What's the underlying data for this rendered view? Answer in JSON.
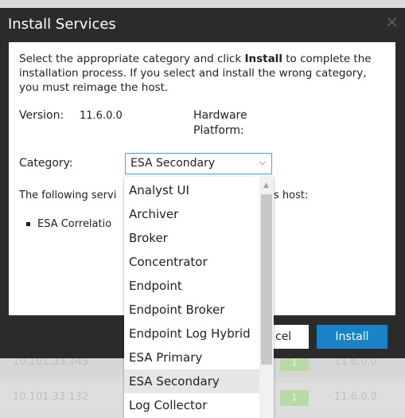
{
  "dialog": {
    "title": "Install Services",
    "close_glyph": "✕",
    "intro_before": "Select the appropriate category and click ",
    "intro_bold": "Install",
    "intro_after": " to complete the installation process. If you select and install the wrong category, you must reimage the host.",
    "version_label": "Version:",
    "version_value": "11.6.0.0",
    "hardware_label_1": "Hardware",
    "hardware_label_2": "Platform:",
    "category_label": "Category:",
    "category_selected": "ESA Secondary",
    "following_text": "The following servi",
    "following_text_end": "s host:",
    "service_item": "ESA Correlatio",
    "cancel_label": "cel",
    "install_label": "Install"
  },
  "dropdown": {
    "options": [
      "Analyst UI",
      "Archiver",
      "Broker",
      "Concentrator",
      "Endpoint",
      "Endpoint Broker",
      "Endpoint Log Hybrid",
      "ESA Primary",
      "ESA Secondary",
      "Log Collector"
    ],
    "selected_index": 8
  },
  "background_rows": [
    {
      "ip": "10.101.33.143",
      "badge": "1",
      "version": "11.6.0.0"
    },
    {
      "ip": "10.101.33.132",
      "badge": "1",
      "version": "11.6.0.0"
    }
  ],
  "colors": {
    "accent": "#1a83c7",
    "dialog_header": "#2b2b2b",
    "select_border": "#57a5d5"
  }
}
